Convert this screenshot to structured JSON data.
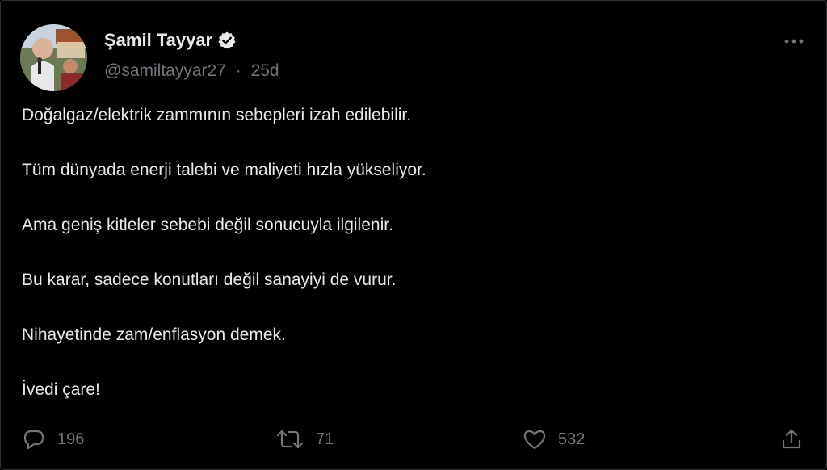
{
  "author": {
    "display_name": "Şamil Tayyar",
    "handle": "@samiltayyar27",
    "separator": "·",
    "timestamp": "25d",
    "verified": true
  },
  "tweet": {
    "paragraphs": [
      "Doğalgaz/elektrik zammının sebepleri izah edilebilir.",
      "Tüm dünyada enerji talebi ve maliyeti hızla yükseliyor.",
      "Ama geniş kitleler sebebi değil sonucuyla ilgilenir.",
      "Bu karar, sadece konutları değil sanayiyi de vurur.",
      "Nihayetinde zam/enflasyon demek.",
      "İvedi çare!"
    ]
  },
  "actions": {
    "reply_count": "196",
    "retweet_count": "71",
    "like_count": "532"
  },
  "icons": {
    "more": "more-horizontal-icon",
    "reply": "reply-icon",
    "retweet": "retweet-icon",
    "like": "heart-icon",
    "share": "share-icon",
    "verified": "verified-badge-icon"
  },
  "colors": {
    "background": "#000000",
    "text_primary": "#e7e9ea",
    "text_secondary": "#71767b",
    "verified_badge": "#e7e9ea"
  }
}
